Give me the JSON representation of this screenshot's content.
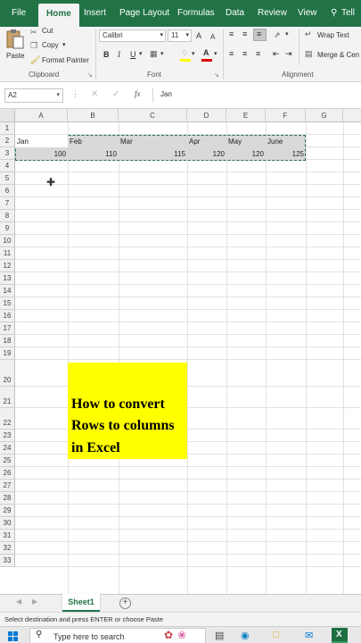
{
  "ribbon": {
    "tabs": [
      "File",
      "Home",
      "Insert",
      "Page Layout",
      "Formulas",
      "Data",
      "Review",
      "View",
      "Tell m"
    ],
    "active_tab": "Home",
    "clipboard": {
      "paste": "Paste",
      "cut": "Cut",
      "copy": "Copy",
      "format_painter": "Format Painter",
      "label": "Clipboard"
    },
    "font": {
      "name": "Calibri",
      "size": "11",
      "grow": "A",
      "shrink": "A",
      "bold": "B",
      "italic": "I",
      "underline": "U",
      "label": "Font"
    },
    "alignment": {
      "wrap_text": "Wrap Text",
      "merge": "Merge & Cen",
      "label": "Alignment"
    }
  },
  "formula_bar": {
    "name_box": "A2",
    "fx": "fx",
    "content": "Jan"
  },
  "grid": {
    "columns": [
      "A",
      "B",
      "C",
      "D",
      "E",
      "F",
      "G"
    ],
    "rows": [
      "1",
      "2",
      "3",
      "4",
      "5",
      "6",
      "7",
      "8",
      "9",
      "10",
      "11",
      "12",
      "13",
      "14",
      "15",
      "16",
      "17",
      "18",
      "19",
      "20",
      "21",
      "22",
      "23",
      "24",
      "25",
      "26",
      "27",
      "28",
      "29",
      "30",
      "31",
      "32",
      "33"
    ],
    "row2": [
      "Jan",
      "Feb",
      "Mar",
      "Apr",
      "May",
      "June"
    ],
    "row3": [
      "100",
      "110",
      "115",
      "120",
      "120",
      "125"
    ]
  },
  "overlay": {
    "lines": [
      "How to convert",
      "Rows to columns",
      "in Excel"
    ]
  },
  "sheet_tabs": {
    "active": "Sheet1",
    "add": "+"
  },
  "status": "Select destination and press ENTER or choose Paste",
  "taskbar": {
    "search_placeholder": "Type here to search"
  },
  "colors": {
    "accent": "#217346",
    "highlight": "#ffff00",
    "selection": "#d9d9d9"
  }
}
